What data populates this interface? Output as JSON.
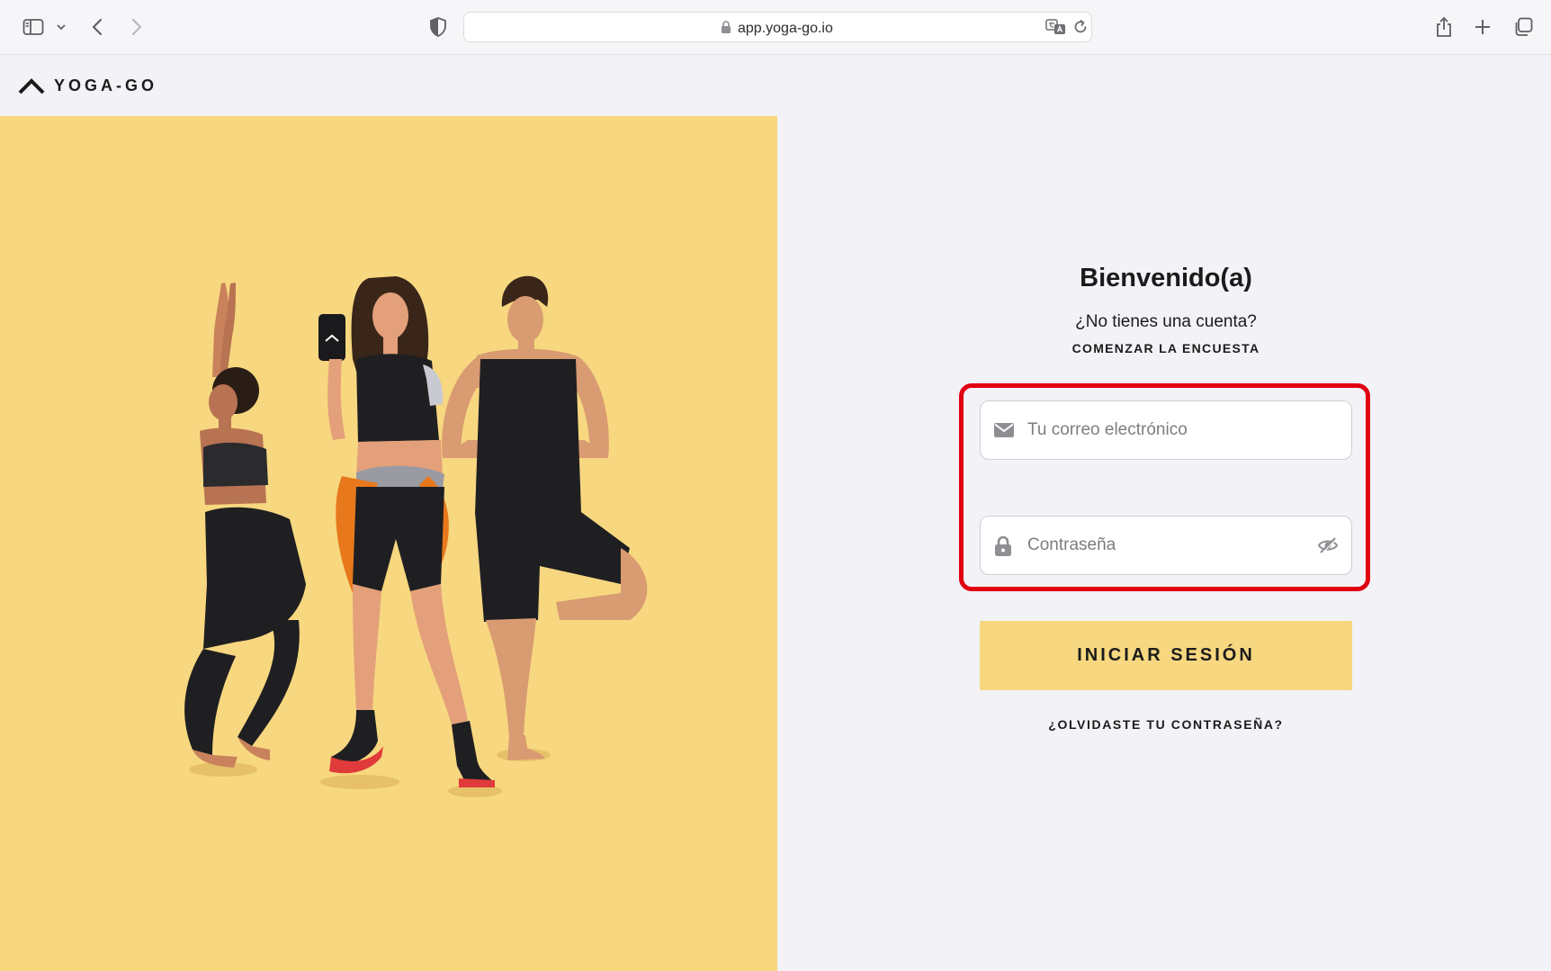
{
  "browser": {
    "url": "app.yoga-go.io",
    "icons": [
      "sidebar-icon",
      "chevron-down-icon",
      "back-icon",
      "forward-icon",
      "shield-icon",
      "lock-icon",
      "translate-icon",
      "reload-icon",
      "share-icon",
      "plus-icon",
      "tabs-icon"
    ]
  },
  "header": {
    "logo_text": "YOGA-GO"
  },
  "login": {
    "title": "Bienvenido(a)",
    "no_account": "¿No tienes una cuenta?",
    "start_survey": "COMENZAR LA ENCUESTA",
    "email_placeholder": "Tu correo electrónico",
    "password_placeholder": "Contraseña",
    "submit_label": "INICIAR SESIÓN",
    "forgot_label": "¿OLVIDASTE TU CONTRASEÑA?"
  },
  "colors": {
    "accent_yellow": "#f7d77f",
    "highlight_red": "#e10012",
    "page_bg": "#f3f2f7"
  }
}
